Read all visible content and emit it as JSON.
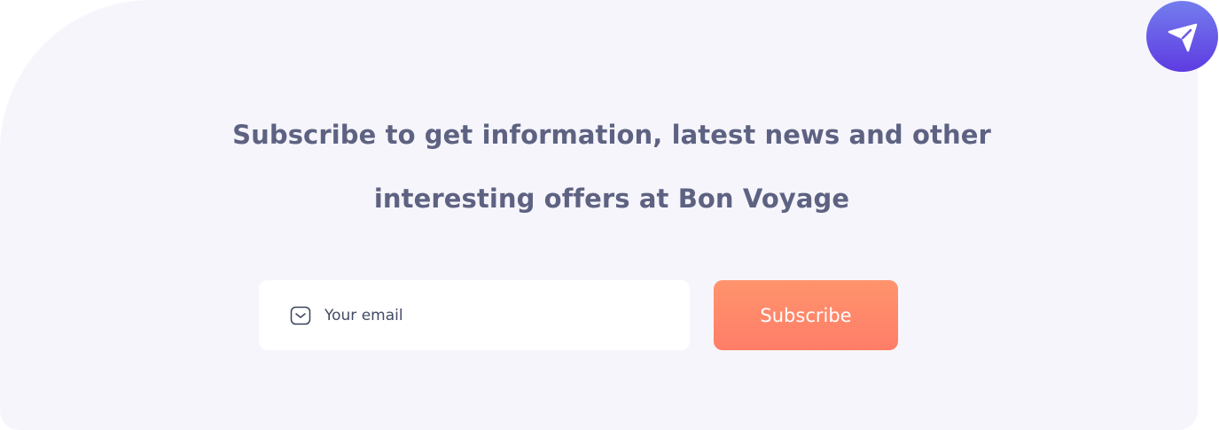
{
  "newsletter": {
    "headline_line1": "Subscribe to get information, latest news and other",
    "headline_line2": "interesting offers at Bon Voyage",
    "email_placeholder": "Your email",
    "email_value": "",
    "mail_icon": "mail-icon",
    "subscribe_label": "Subscribe",
    "send_icon": "paper-plane-icon"
  },
  "colors": {
    "panel_background": "#f6f5fb",
    "headline_text": "#5e6282",
    "button_gradient_top": "#ff946d",
    "button_gradient_bottom": "#ff7d68",
    "badge_gradient_top": "#747dee",
    "badge_gradient_bottom": "#5e3be1"
  }
}
